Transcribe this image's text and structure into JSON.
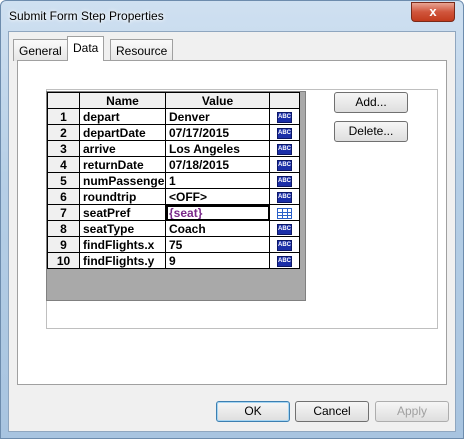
{
  "window": {
    "title": "Submit Form Step Properties"
  },
  "titlebar": {
    "close_label": "x"
  },
  "tabs": [
    {
      "label": "General"
    },
    {
      "label": "Data"
    },
    {
      "label": "Resource"
    }
  ],
  "grid": {
    "headers": {
      "num": "",
      "name": "Name",
      "value": "Value"
    },
    "rows": [
      {
        "num": "1",
        "name": "depart",
        "value": "Denver",
        "icon": "abc-icon"
      },
      {
        "num": "2",
        "name": "departDate",
        "value": "07/17/2015",
        "icon": "abc-icon"
      },
      {
        "num": "3",
        "name": "arrive",
        "value": "Los Angeles",
        "icon": "abc-icon"
      },
      {
        "num": "4",
        "name": "returnDate",
        "value": "07/18/2015",
        "icon": "abc-icon"
      },
      {
        "num": "5",
        "name": "numPassenger",
        "value": "1",
        "icon": "abc-icon"
      },
      {
        "num": "6",
        "name": "roundtrip",
        "value": "<OFF>",
        "icon": "abc-icon"
      },
      {
        "num": "7",
        "name": "seatPref",
        "value": "{seat}",
        "icon": "table-icon"
      },
      {
        "num": "8",
        "name": "seatType",
        "value": "Coach",
        "icon": "abc-icon"
      },
      {
        "num": "9",
        "name": "findFlights.x",
        "value": "75",
        "icon": "abc-icon"
      },
      {
        "num": "10",
        "name": "findFlights.y",
        "value": "9",
        "icon": "abc-icon"
      }
    ],
    "abc_label": "ABC"
  },
  "side_buttons": {
    "add": "Add...",
    "delete": "Delete..."
  },
  "footer": {
    "ok": "OK",
    "cancel": "Cancel",
    "apply": "Apply"
  }
}
